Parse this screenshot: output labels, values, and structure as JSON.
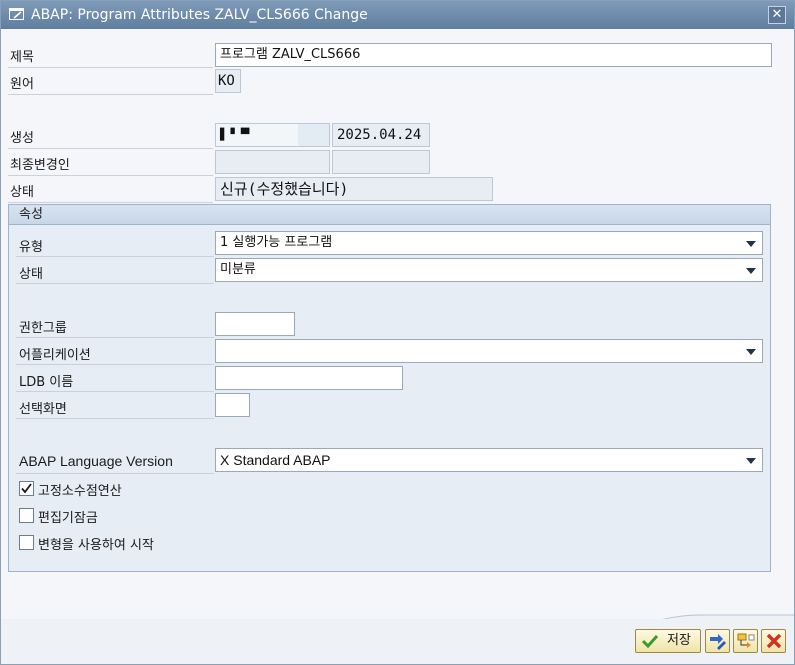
{
  "window": {
    "title": "ABAP: Program Attributes ZALV_CLS666 Change"
  },
  "header": {
    "title_label": "제목",
    "title_value": "프로그램 ZALV_CLS666",
    "lang_label": "원어",
    "lang_value": "KO",
    "created_label": "생성",
    "created_user": "▌▘▀",
    "created_date": "2025.04.24",
    "changed_label": "최종변경인",
    "changed_user": "",
    "changed_date": "",
    "status_label": "상태",
    "status_value": "신규(수정했습니다)"
  },
  "attributes": {
    "group_title": "속성",
    "type_label": "유형",
    "type_value": "1 실행가능 프로그램",
    "status_label": "상태",
    "status_value": "미분류",
    "auth_group_label": "권한그룹",
    "auth_group_value": "",
    "application_label": "어플리케이션",
    "application_value": "",
    "ldb_label": "LDB 이름",
    "ldb_value": "",
    "selscreen_label": "선택화면",
    "selscreen_value": "",
    "abap_lang_label": "ABAP Language Version",
    "abap_lang_value": "X Standard ABAP",
    "fixed_point_label": "고정소수점연산",
    "fixed_point_checked": true,
    "editor_lock_label": "편집기잠금",
    "editor_lock_checked": false,
    "variant_start_label": "변형을 사용하여 시작",
    "variant_start_checked": false
  },
  "footer": {
    "save_label": "저장",
    "accent_color": "#f0e4a8"
  }
}
